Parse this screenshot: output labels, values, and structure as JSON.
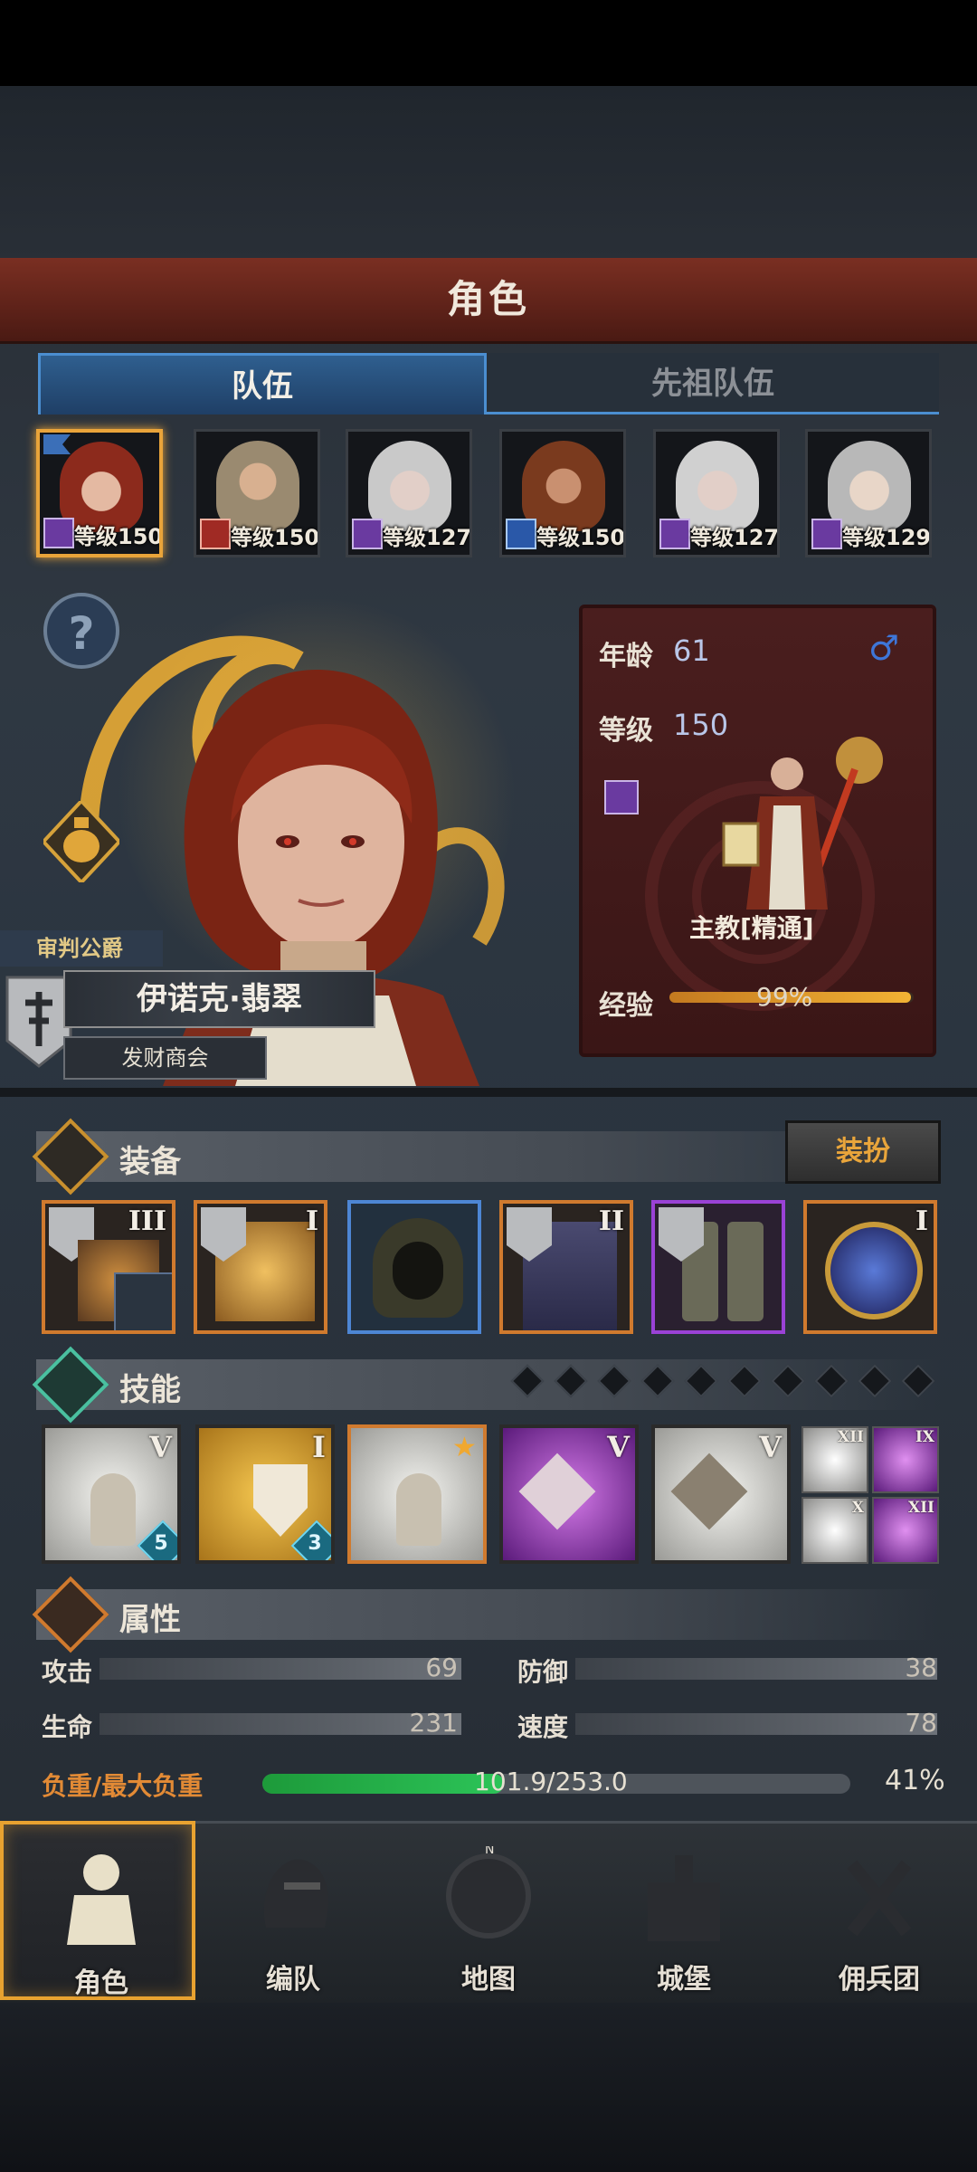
{
  "title": "角色",
  "tabs": {
    "team": "队伍",
    "ancestor": "先祖队伍"
  },
  "roster": [
    {
      "level_text": "等级150"
    },
    {
      "level_text": "等级150"
    },
    {
      "level_text": "等级127"
    },
    {
      "level_text": "等级150"
    },
    {
      "level_text": "等级127"
    },
    {
      "level_text": "等级129"
    }
  ],
  "hero": {
    "title_tag": "审判公爵",
    "name": "伊诺克·翡翠",
    "guild": "发财商会"
  },
  "info": {
    "age_label": "年龄",
    "age": "61",
    "gender_symbol": "♂",
    "level_label": "等级",
    "level": "150",
    "class_name": "主教[精通]",
    "exp_label": "经验",
    "exp_pct": "99%",
    "exp_fraction": 0.99
  },
  "equipment": {
    "title": "装备",
    "dress_button": "装扮",
    "items": [
      {
        "rank": "III"
      },
      {
        "rank": "I"
      },
      {
        "rank": ""
      },
      {
        "rank": "II"
      },
      {
        "rank": ""
      },
      {
        "rank": "I"
      }
    ]
  },
  "skills": {
    "title": "技能",
    "main": [
      {
        "rank": "V",
        "count": "5"
      },
      {
        "rank": "I",
        "count": "3"
      },
      {
        "rank": "",
        "count": ""
      },
      {
        "rank": "V",
        "count": ""
      },
      {
        "rank": "V",
        "count": ""
      }
    ],
    "mini": [
      {
        "rank": "XII"
      },
      {
        "rank": "IX"
      },
      {
        "rank": "X"
      },
      {
        "rank": "XII"
      }
    ]
  },
  "attributes": {
    "title": "属性",
    "attack_label": "攻击",
    "attack": "69",
    "defense_label": "防御",
    "defense": "38",
    "hp_label": "生命",
    "hp": "231",
    "speed_label": "速度",
    "speed": "78",
    "load_label": "负重/最大负重",
    "load_value": "101.9/253.0",
    "load_pct": "41%",
    "load_fraction": 0.41
  },
  "nav": [
    {
      "label": "角色"
    },
    {
      "label": "编队"
    },
    {
      "label": "地图"
    },
    {
      "label": "城堡"
    },
    {
      "label": "佣兵团"
    }
  ],
  "colors": {
    "accent_gold": "#e9a43a",
    "tab_blue": "#4b8ed0",
    "title_red": "#5e2219",
    "load_green": "#2cc458",
    "rarity_orange": "#d07a2e",
    "rarity_purple": "#9a42d6",
    "rarity_blue": "#4d86d4"
  }
}
